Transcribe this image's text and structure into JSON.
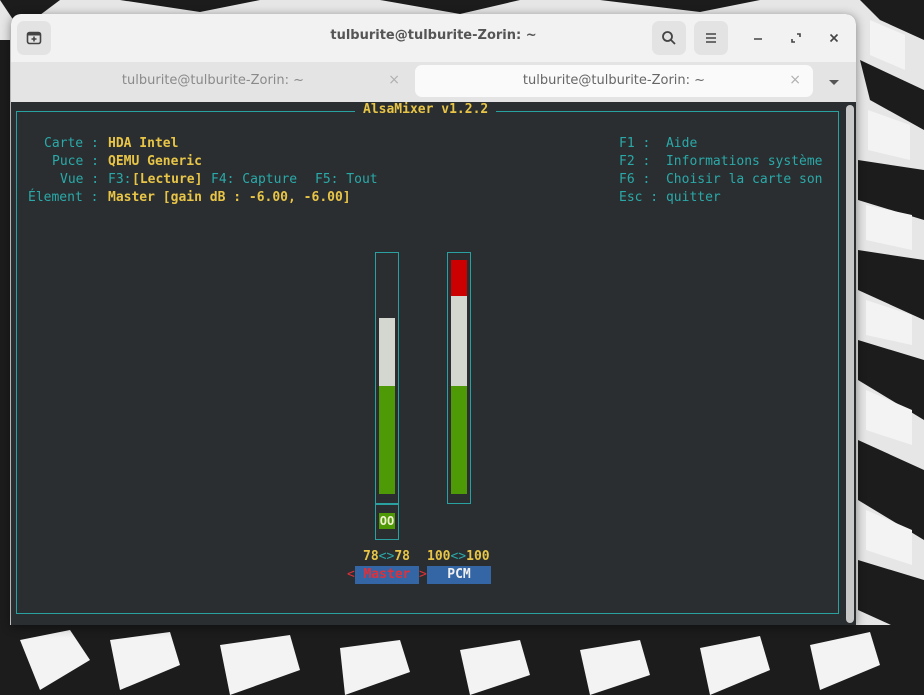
{
  "window": {
    "title": "tulburite@tulburite-Zorin: ~",
    "tabs": [
      {
        "label": "tulburite@tulburite-Zorin: ~",
        "active": false
      },
      {
        "label": "tulburite@tulburite-Zorin: ~",
        "active": true
      }
    ],
    "tab_close": "×"
  },
  "mixer": {
    "title": "AlsaMixer v1.2.2",
    "info": {
      "card_label": "Carte :",
      "card_value": "HDA Intel",
      "chip_label": "Puce :",
      "chip_value": "QEMU Generic",
      "view_label": "Vue :",
      "view_f3": "F3:",
      "view_playback": "[Lecture]",
      "view_f4": "F4: Capture",
      "view_f5": "F5: Tout",
      "element_label": "Élement :",
      "element_value": "Master [gain dB : -6.00, -6.00]"
    },
    "help": {
      "f1": "F1 :  Aide",
      "f2": "F2 :  Informations système",
      "f6": "F6 :  Choisir la carte son",
      "esc": "Esc : quitter"
    },
    "channels": [
      {
        "name": "Master",
        "left": "78",
        "sep": "<>",
        "right": "78",
        "level_percent": 78,
        "mute_indicator": "OO",
        "selected": true,
        "label_color": "#e0303a",
        "label_bg": "#3465a4"
      },
      {
        "name": "PCM",
        "left": "100",
        "sep": "<>",
        "right": "100",
        "level_percent": 100,
        "selected": false,
        "label_color": "#f0f0f0",
        "label_bg": "#3465a4"
      }
    ]
  },
  "colors": {
    "bar_green": "#4e9a06",
    "bar_white": "#d3d7cf",
    "bar_red": "#cc0000",
    "cyan": "#2aa9a9",
    "yellow": "#e8c547"
  }
}
